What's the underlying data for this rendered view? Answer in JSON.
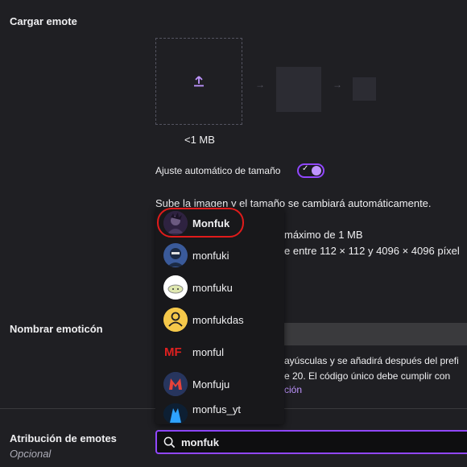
{
  "upload_section": {
    "title": "Cargar emote",
    "size_limit": "<1 MB",
    "auto_resize_label": "Ajuste automático de tamaño",
    "auto_resize_enabled": true,
    "description": "Sube la imagen y el tamaño se cambiará automáticamente.",
    "max_size_fragment": "máximo de 1 MB",
    "dimensions_fragment": "e entre 112 × 112 y 4096 × 4096 píxel"
  },
  "name_section": {
    "title": "Nombrar emoticón",
    "help_fragment_1": "ayúsculas y se añadirá después del prefi",
    "help_fragment_2": "e 20. El código único debe cumplir con",
    "link_fragment": "ción"
  },
  "attribution_section": {
    "title": "Atribución de emotes",
    "optional_label": "Opcional"
  },
  "search": {
    "value": "monfuk",
    "icon": "search-icon"
  },
  "dropdown": {
    "highlight_color": "#e01b1b",
    "items": [
      {
        "label": "Monfuk",
        "avatar": "dark-character-avatar"
      },
      {
        "label": "monfuki",
        "avatar": "blue-character-avatar"
      },
      {
        "label": "monfuku",
        "avatar": "white-cloud-avatar"
      },
      {
        "label": "monfukdas",
        "avatar": "default-user-avatar"
      },
      {
        "label": "monful",
        "avatar": "red-mf-logo-avatar"
      },
      {
        "label": "Monfuju",
        "avatar": "m-logo-avatar"
      },
      {
        "label": "monfus_yt",
        "avatar": "blue-figure-avatar"
      }
    ]
  },
  "colors": {
    "accent": "#9147ff",
    "background": "#1f1f23",
    "text": "#efeff1"
  }
}
